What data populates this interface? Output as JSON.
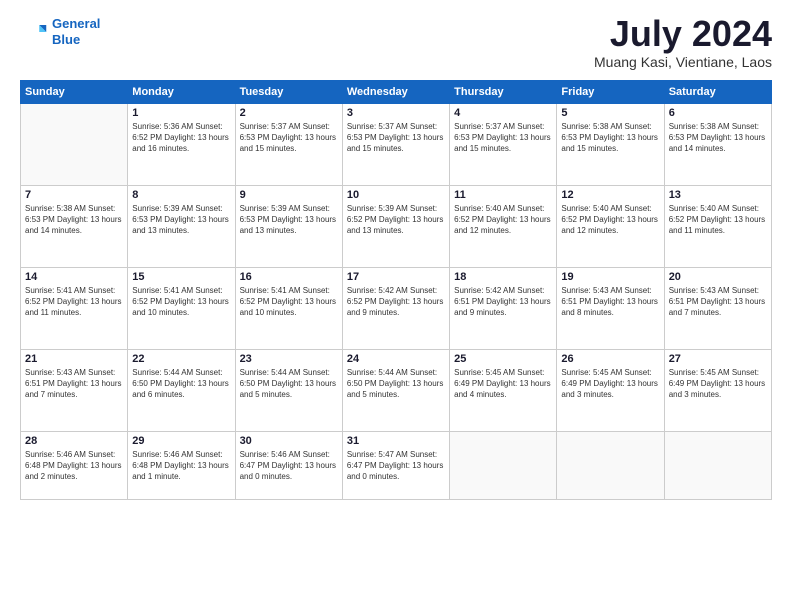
{
  "header": {
    "logo_line1": "General",
    "logo_line2": "Blue",
    "month_year": "July 2024",
    "location": "Muang Kasi, Vientiane, Laos"
  },
  "days_of_week": [
    "Sunday",
    "Monday",
    "Tuesday",
    "Wednesday",
    "Thursday",
    "Friday",
    "Saturday"
  ],
  "weeks": [
    [
      {
        "day": "",
        "info": ""
      },
      {
        "day": "1",
        "info": "Sunrise: 5:36 AM\nSunset: 6:52 PM\nDaylight: 13 hours\nand 16 minutes."
      },
      {
        "day": "2",
        "info": "Sunrise: 5:37 AM\nSunset: 6:53 PM\nDaylight: 13 hours\nand 15 minutes."
      },
      {
        "day": "3",
        "info": "Sunrise: 5:37 AM\nSunset: 6:53 PM\nDaylight: 13 hours\nand 15 minutes."
      },
      {
        "day": "4",
        "info": "Sunrise: 5:37 AM\nSunset: 6:53 PM\nDaylight: 13 hours\nand 15 minutes."
      },
      {
        "day": "5",
        "info": "Sunrise: 5:38 AM\nSunset: 6:53 PM\nDaylight: 13 hours\nand 15 minutes."
      },
      {
        "day": "6",
        "info": "Sunrise: 5:38 AM\nSunset: 6:53 PM\nDaylight: 13 hours\nand 14 minutes."
      }
    ],
    [
      {
        "day": "7",
        "info": "Sunrise: 5:38 AM\nSunset: 6:53 PM\nDaylight: 13 hours\nand 14 minutes."
      },
      {
        "day": "8",
        "info": "Sunrise: 5:39 AM\nSunset: 6:53 PM\nDaylight: 13 hours\nand 13 minutes."
      },
      {
        "day": "9",
        "info": "Sunrise: 5:39 AM\nSunset: 6:53 PM\nDaylight: 13 hours\nand 13 minutes."
      },
      {
        "day": "10",
        "info": "Sunrise: 5:39 AM\nSunset: 6:52 PM\nDaylight: 13 hours\nand 13 minutes."
      },
      {
        "day": "11",
        "info": "Sunrise: 5:40 AM\nSunset: 6:52 PM\nDaylight: 13 hours\nand 12 minutes."
      },
      {
        "day": "12",
        "info": "Sunrise: 5:40 AM\nSunset: 6:52 PM\nDaylight: 13 hours\nand 12 minutes."
      },
      {
        "day": "13",
        "info": "Sunrise: 5:40 AM\nSunset: 6:52 PM\nDaylight: 13 hours\nand 11 minutes."
      }
    ],
    [
      {
        "day": "14",
        "info": "Sunrise: 5:41 AM\nSunset: 6:52 PM\nDaylight: 13 hours\nand 11 minutes."
      },
      {
        "day": "15",
        "info": "Sunrise: 5:41 AM\nSunset: 6:52 PM\nDaylight: 13 hours\nand 10 minutes."
      },
      {
        "day": "16",
        "info": "Sunrise: 5:41 AM\nSunset: 6:52 PM\nDaylight: 13 hours\nand 10 minutes."
      },
      {
        "day": "17",
        "info": "Sunrise: 5:42 AM\nSunset: 6:52 PM\nDaylight: 13 hours\nand 9 minutes."
      },
      {
        "day": "18",
        "info": "Sunrise: 5:42 AM\nSunset: 6:51 PM\nDaylight: 13 hours\nand 9 minutes."
      },
      {
        "day": "19",
        "info": "Sunrise: 5:43 AM\nSunset: 6:51 PM\nDaylight: 13 hours\nand 8 minutes."
      },
      {
        "day": "20",
        "info": "Sunrise: 5:43 AM\nSunset: 6:51 PM\nDaylight: 13 hours\nand 7 minutes."
      }
    ],
    [
      {
        "day": "21",
        "info": "Sunrise: 5:43 AM\nSunset: 6:51 PM\nDaylight: 13 hours\nand 7 minutes."
      },
      {
        "day": "22",
        "info": "Sunrise: 5:44 AM\nSunset: 6:50 PM\nDaylight: 13 hours\nand 6 minutes."
      },
      {
        "day": "23",
        "info": "Sunrise: 5:44 AM\nSunset: 6:50 PM\nDaylight: 13 hours\nand 5 minutes."
      },
      {
        "day": "24",
        "info": "Sunrise: 5:44 AM\nSunset: 6:50 PM\nDaylight: 13 hours\nand 5 minutes."
      },
      {
        "day": "25",
        "info": "Sunrise: 5:45 AM\nSunset: 6:49 PM\nDaylight: 13 hours\nand 4 minutes."
      },
      {
        "day": "26",
        "info": "Sunrise: 5:45 AM\nSunset: 6:49 PM\nDaylight: 13 hours\nand 3 minutes."
      },
      {
        "day": "27",
        "info": "Sunrise: 5:45 AM\nSunset: 6:49 PM\nDaylight: 13 hours\nand 3 minutes."
      }
    ],
    [
      {
        "day": "28",
        "info": "Sunrise: 5:46 AM\nSunset: 6:48 PM\nDaylight: 13 hours\nand 2 minutes."
      },
      {
        "day": "29",
        "info": "Sunrise: 5:46 AM\nSunset: 6:48 PM\nDaylight: 13 hours\nand 1 minute."
      },
      {
        "day": "30",
        "info": "Sunrise: 5:46 AM\nSunset: 6:47 PM\nDaylight: 13 hours\nand 0 minutes."
      },
      {
        "day": "31",
        "info": "Sunrise: 5:47 AM\nSunset: 6:47 PM\nDaylight: 13 hours\nand 0 minutes."
      },
      {
        "day": "",
        "info": ""
      },
      {
        "day": "",
        "info": ""
      },
      {
        "day": "",
        "info": ""
      }
    ]
  ]
}
